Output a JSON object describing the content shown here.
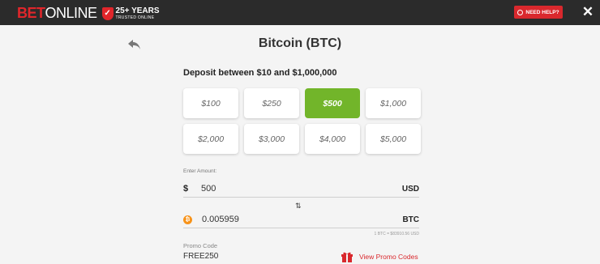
{
  "header": {
    "logo_bet": "BET",
    "logo_online": "ONLINE",
    "badge_big": "25+ YEARS",
    "badge_small": "TRUSTED ONLINE",
    "help_label": "NEED HELP?",
    "close_symbol": "✕"
  },
  "page": {
    "title": "Bitcoin (BTC)",
    "deposit_range": "Deposit between $10 and $1,000,000"
  },
  "amounts": [
    {
      "label": "$100",
      "selected": false
    },
    {
      "label": "$250",
      "selected": false
    },
    {
      "label": "$500",
      "selected": true
    },
    {
      "label": "$1,000",
      "selected": false
    },
    {
      "label": "$2,000",
      "selected": false
    },
    {
      "label": "$3,000",
      "selected": false
    },
    {
      "label": "$4,000",
      "selected": false
    },
    {
      "label": "$5,000",
      "selected": false
    }
  ],
  "enter_amount": {
    "label": "Enter Amount:",
    "usd_symbol": "$",
    "usd_value": "500",
    "usd_code": "USD",
    "btc_symbol": "₿",
    "btc_value": "0.005959",
    "btc_code": "BTC",
    "swap_symbol": "⇅",
    "rate": "1 BTC = $83910.56 USD"
  },
  "promo": {
    "label": "Promo Code",
    "value": "FREE250",
    "link": "View Promo Codes"
  },
  "colors": {
    "brand_red": "#e0262b",
    "selected_green": "#72b52a",
    "bitcoin_orange": "#f7931a"
  }
}
